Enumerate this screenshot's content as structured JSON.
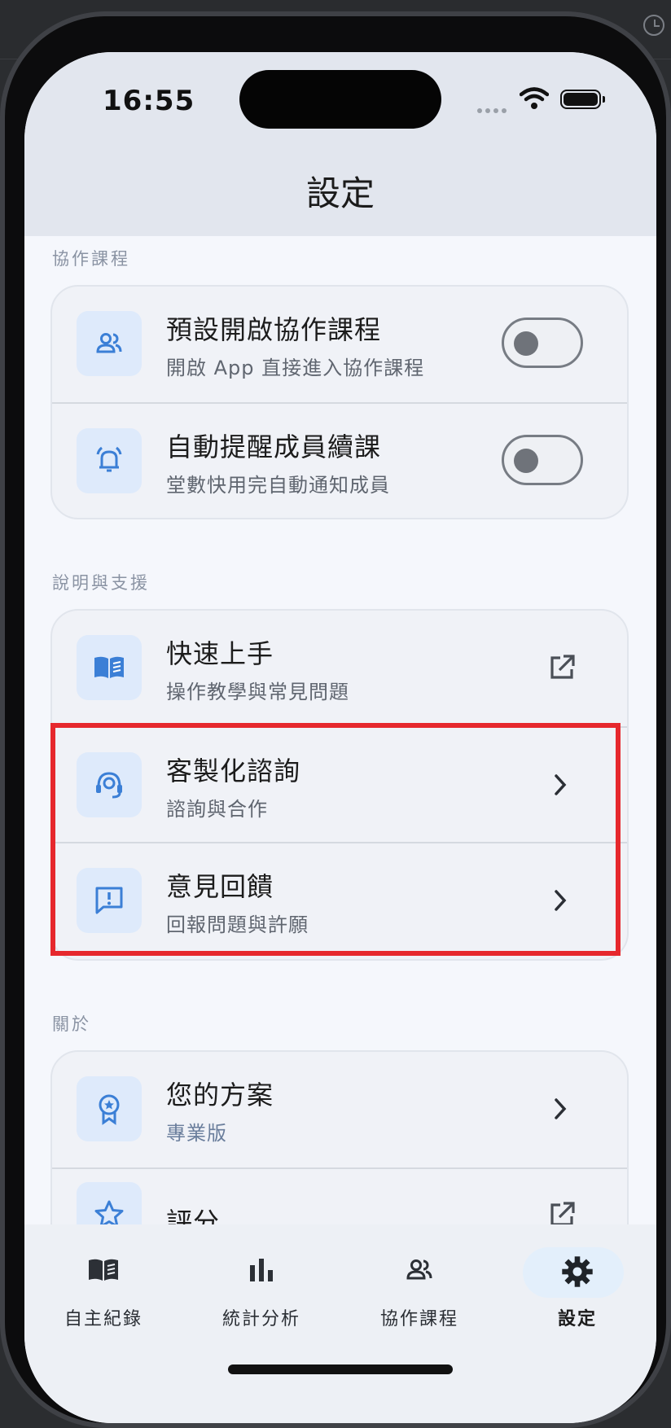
{
  "status_bar": {
    "time": "16:55"
  },
  "header": {
    "title": "設定"
  },
  "sections": {
    "collab": {
      "label": "協作課程",
      "items": [
        {
          "title": "預設開啟協作課程",
          "subtitle": "開啟 App 直接進入協作課程",
          "icon": "people-icon",
          "toggle": false
        },
        {
          "title": "自動提醒成員續課",
          "subtitle": "堂數快用完自動通知成員",
          "icon": "bell-icon",
          "toggle": false
        }
      ]
    },
    "support": {
      "label": "說明與支援",
      "items": [
        {
          "title": "快速上手",
          "subtitle": "操作教學與常見問題",
          "icon": "book-icon",
          "action": "external-link-icon"
        },
        {
          "title": "客製化諮詢",
          "subtitle": "諮詢與合作",
          "icon": "headset-icon",
          "action": "chevron-right-icon"
        },
        {
          "title": "意見回饋",
          "subtitle": "回報問題與許願",
          "icon": "feedback-icon",
          "action": "chevron-right-icon"
        }
      ]
    },
    "about": {
      "label": "關於",
      "items": [
        {
          "title": "您的方案",
          "subtitle": "專業版",
          "icon": "badge-icon",
          "action": "chevron-right-icon"
        },
        {
          "title": "評分",
          "icon": "star-icon",
          "action": "external-link-icon"
        }
      ]
    }
  },
  "tabs": [
    {
      "label": "自主紀錄",
      "icon": "book-icon"
    },
    {
      "label": "統計分析",
      "icon": "bar-chart-icon"
    },
    {
      "label": "協作課程",
      "icon": "people-icon"
    },
    {
      "label": "設定",
      "icon": "gear-icon",
      "active": true
    }
  ],
  "colors": {
    "accent": "#4a90e2",
    "highlight": "#e6282d"
  }
}
